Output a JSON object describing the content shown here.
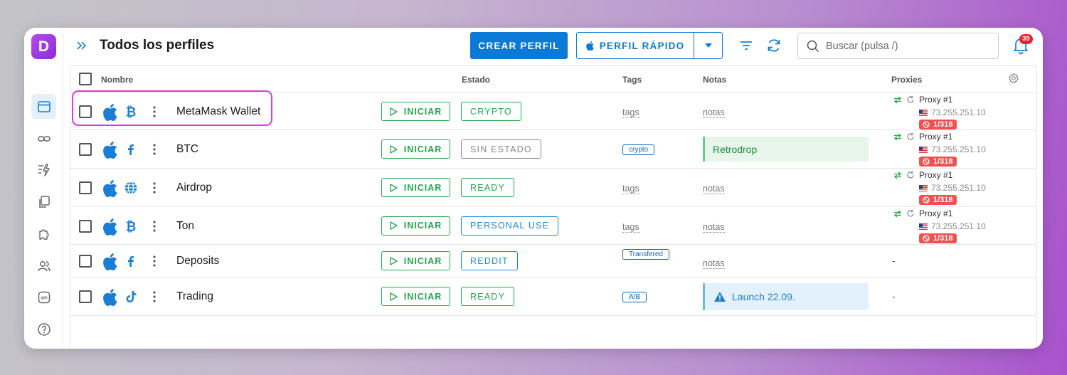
{
  "sidebar": {
    "logo_letter": "D",
    "icons": [
      "browser-window-icon",
      "link-icon",
      "lightning-list-icon",
      "copy-icon",
      "puzzle-icon",
      "users-icon",
      "api-icon",
      "help-icon"
    ],
    "api_label": "API"
  },
  "header": {
    "title": "Todos los perfiles",
    "create_label": "CREAR PERFIL",
    "quick_label": "PERFIL RÁPIDO",
    "search_placeholder": "Buscar (pulsa /)",
    "notification_count": "39"
  },
  "table": {
    "columns": {
      "name": "Nombre",
      "status": "Estado",
      "tags": "Tags",
      "notes": "Notas",
      "proxies": "Proxies"
    },
    "start_label": "INICIAR",
    "rows": [
      {
        "name": "MetaMask Wallet",
        "os_icon": "apple-icon",
        "browser_icon": "bitcoin-icon",
        "status": "CRYPTO",
        "status_color": "#21a84a",
        "tag": "tags",
        "tag_is_placeholder": true,
        "note": "notas",
        "note_style": "placeholder",
        "proxy": {
          "name": "Proxy #1",
          "ip": "73.255.251.10",
          "count": "1/318"
        },
        "highlighted": true
      },
      {
        "name": "BTC",
        "os_icon": "apple-icon",
        "browser_icon": "facebook-icon",
        "status": "SIN ESTADO",
        "status_color": "#8a8a8a",
        "tag": "crypto",
        "tag_is_placeholder": false,
        "note": "Retrodrop",
        "note_style": "green",
        "proxy": {
          "name": "Proxy #1",
          "ip": "73.255.251.10",
          "count": "1/318"
        }
      },
      {
        "name": "Airdrop",
        "os_icon": "apple-icon",
        "browser_icon": "globe-icon",
        "status": "READY",
        "status_color": "#21a84a",
        "tag": "tags",
        "tag_is_placeholder": true,
        "note": "notas",
        "note_style": "placeholder",
        "proxy": {
          "name": "Proxy #1",
          "ip": "73.255.251.10",
          "count": "1/318"
        }
      },
      {
        "name": "Ton",
        "os_icon": "apple-icon",
        "browser_icon": "bitcoin-icon",
        "status": "PERSONAL USE",
        "status_color": "#1a8ad6",
        "tag": "tags",
        "tag_is_placeholder": true,
        "note": "notas",
        "note_style": "placeholder",
        "proxy": {
          "name": "Proxy #1",
          "ip": "73.255.251.10",
          "count": "1/318"
        }
      },
      {
        "name": "Deposits",
        "os_icon": "apple-icon",
        "browser_icon": "facebook-icon",
        "status": "REDDIT",
        "status_color": "#1a8ad6",
        "tag": "Transfered",
        "tag_is_placeholder": false,
        "note": "notas",
        "note_style": "placeholder",
        "proxy_text": "-"
      },
      {
        "name": "Trading",
        "os_icon": "apple-icon",
        "browser_icon": "tiktok-icon",
        "status": "READY",
        "status_color": "#21a84a",
        "tag": "A/B",
        "tag_is_placeholder": false,
        "note": "Launch 22.09.",
        "note_style": "blue-warning",
        "proxy_text": "-"
      }
    ]
  }
}
